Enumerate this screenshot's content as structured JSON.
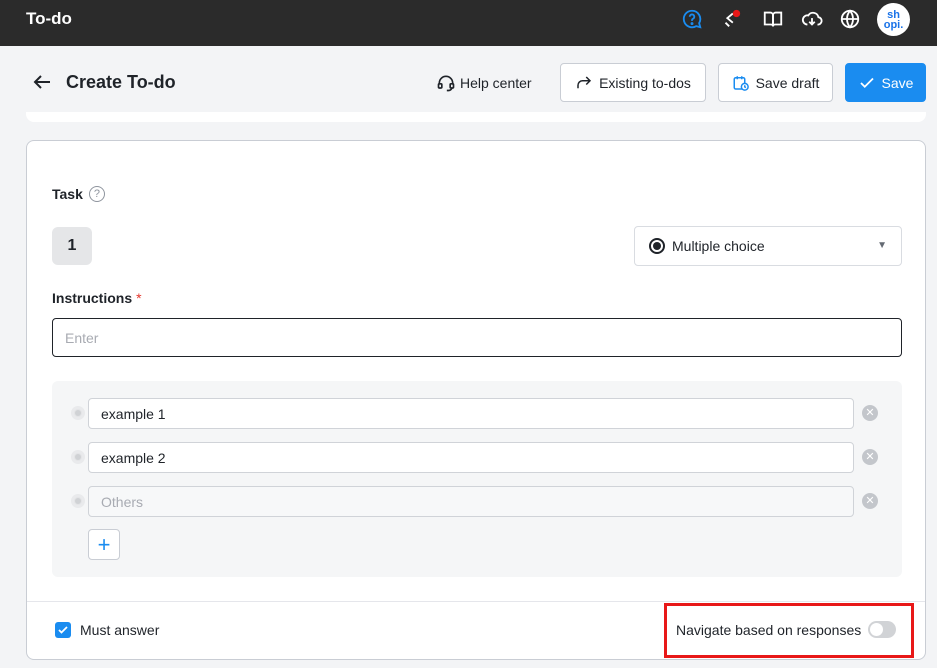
{
  "app": {
    "title": "To-do",
    "avatar_text": "sh opi."
  },
  "header": {
    "title": "Create To-do",
    "help_label": "Help center",
    "existing_label": "Existing to-dos",
    "draft_label": "Save draft",
    "save_label": "Save"
  },
  "task": {
    "label": "Task",
    "help_glyph": "?",
    "number": "1",
    "type": "Multiple choice",
    "instructions_label": "Instructions",
    "required_mark": "*",
    "instructions_placeholder": "Enter",
    "instructions_value": ""
  },
  "options": [
    {
      "value": "example 1",
      "placeholder": ""
    },
    {
      "value": "example 2",
      "placeholder": ""
    },
    {
      "value": "",
      "placeholder": "Others"
    }
  ],
  "footer": {
    "must_answer_label": "Must answer",
    "must_answer_checked": true,
    "navigate_label": "Navigate based on responses",
    "navigate_enabled": false
  },
  "colors": {
    "accent": "#1a8cf0",
    "topbar": "#2b2b2b",
    "highlight": "#e81818"
  },
  "icons": [
    "help-question-icon",
    "share-icon",
    "book-icon",
    "cloud-download-icon",
    "globe-icon",
    "arrow-left-icon",
    "headset-icon",
    "forward-icon",
    "calendar-clock-icon",
    "check-icon",
    "plus-icon",
    "remove-icon"
  ]
}
